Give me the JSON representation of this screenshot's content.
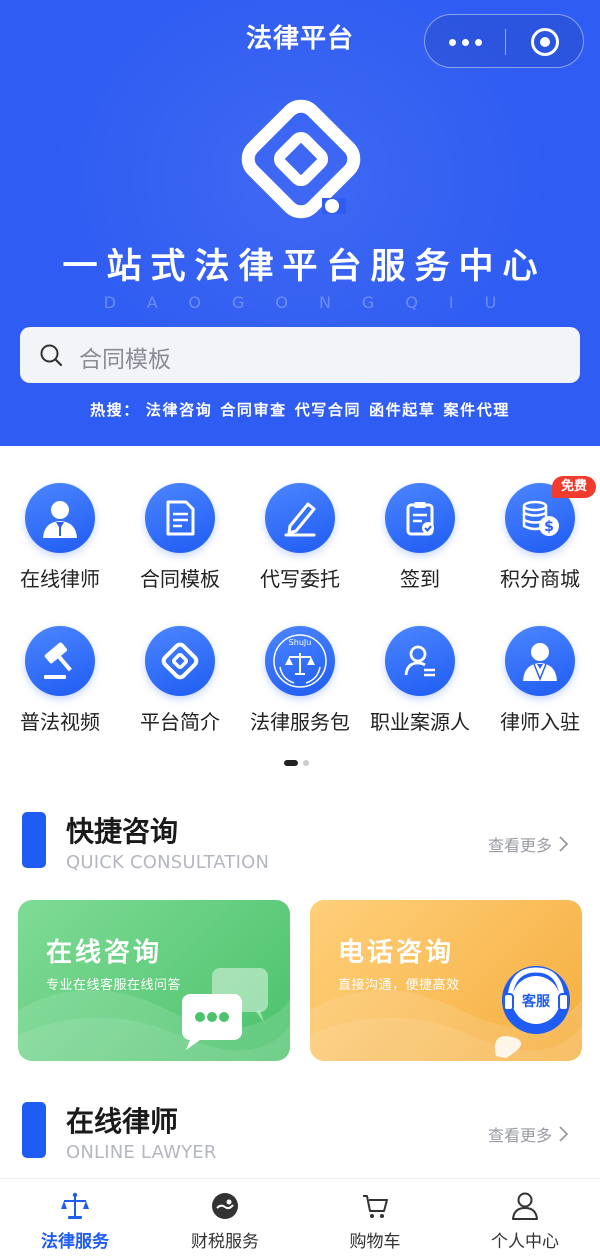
{
  "header": {
    "title": "法律平台",
    "slogan": "一站式法律平台服务中心",
    "slogan_en": "DAOGONGQIU",
    "search_placeholder": "合同模板",
    "hot_label": "热搜：",
    "hot_items": [
      "法律咨询",
      "合同审查",
      "代写合同",
      "函件起草",
      "案件代理"
    ]
  },
  "grid": {
    "items": [
      {
        "label": "在线律师",
        "icon": "lawyer-avatar-icon"
      },
      {
        "label": "合同模板",
        "icon": "document-icon"
      },
      {
        "label": "代写委托",
        "icon": "pen-icon"
      },
      {
        "label": "签到",
        "icon": "clipboard-check-icon"
      },
      {
        "label": "积分商城",
        "icon": "coins-icon"
      },
      {
        "label": "普法视频",
        "icon": "gavel-icon"
      },
      {
        "label": "平台简介",
        "icon": "platform-logo-icon"
      },
      {
        "label": "法律服务包",
        "icon": "justice-seal-icon"
      },
      {
        "label": "职业案源人",
        "icon": "person-list-icon"
      },
      {
        "label": "律师入驻",
        "icon": "lawyer-join-icon"
      }
    ],
    "badge": "免费",
    "seal_text": "ShuJu"
  },
  "sections": {
    "quick": {
      "title": "快捷咨询",
      "subtitle": "QUICK CONSULTATION",
      "more": "查看更多"
    },
    "lawyer": {
      "title": "在线律师",
      "subtitle": "ONLINE LAWYER",
      "more": "查看更多"
    }
  },
  "cards": {
    "online": {
      "title": "在线咨询",
      "desc": "专业在线客服在线问答"
    },
    "phone": {
      "title": "电话咨询",
      "desc": "直接沟通，便捷高效",
      "service_label": "客服"
    }
  },
  "tabbar": {
    "items": [
      {
        "label": "法律服务",
        "icon": "scales-icon",
        "active": true
      },
      {
        "label": "财税服务",
        "icon": "finance-icon",
        "active": false
      },
      {
        "label": "购物车",
        "icon": "cart-icon",
        "active": false
      },
      {
        "label": "个人中心",
        "icon": "user-icon",
        "active": false
      }
    ]
  },
  "colors": {
    "primary": "#2f5cf2",
    "badge": "#f23b2f",
    "green_card": "#4bc26b",
    "orange_card": "#f5ae3e"
  }
}
